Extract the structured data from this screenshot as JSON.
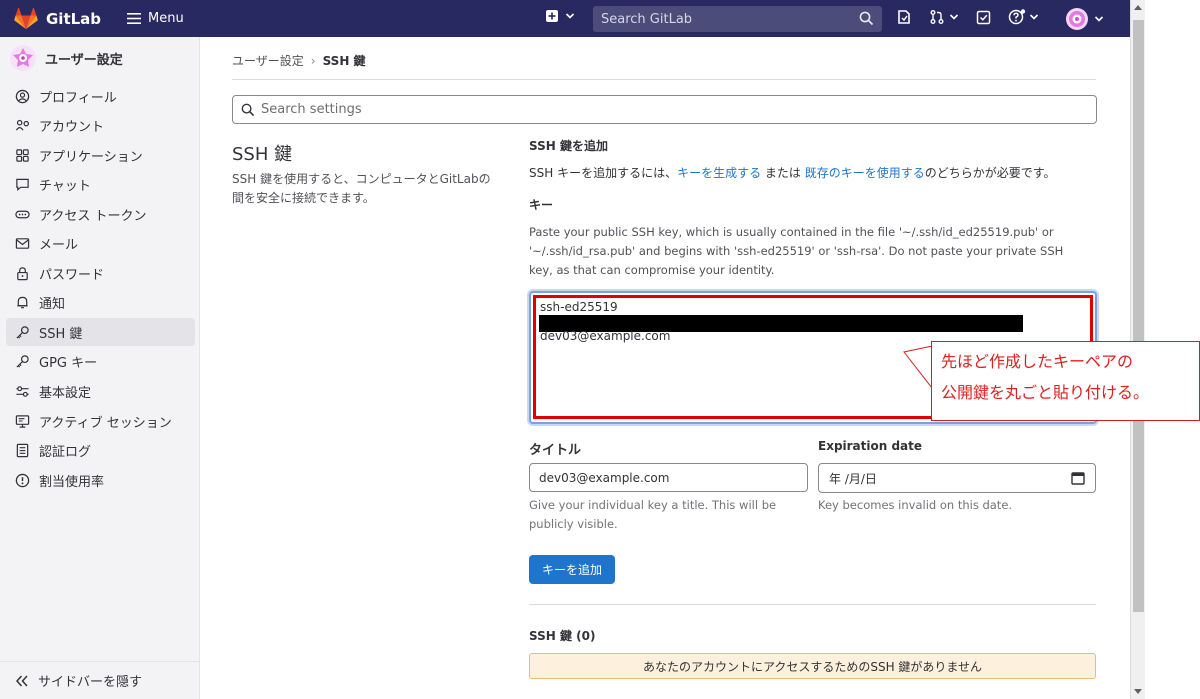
{
  "topbar": {
    "brand": "GitLab",
    "menu_label": "Menu",
    "search_placeholder": "Search GitLab",
    "colors": {
      "background": "#292961",
      "logo": "#e24329"
    }
  },
  "sidebar": {
    "title": "ユーザー設定",
    "items": [
      {
        "label": "プロフィール",
        "icon": "profile-icon"
      },
      {
        "label": "アカウント",
        "icon": "account-icon"
      },
      {
        "label": "アプリケーション",
        "icon": "applications-icon"
      },
      {
        "label": "チャット",
        "icon": "chat-icon"
      },
      {
        "label": "アクセス トークン",
        "icon": "token-icon"
      },
      {
        "label": "メール",
        "icon": "mail-icon"
      },
      {
        "label": "パスワード",
        "icon": "lock-icon"
      },
      {
        "label": "通知",
        "icon": "bell-icon"
      },
      {
        "label": "SSH 鍵",
        "icon": "key-icon",
        "active": true
      },
      {
        "label": "GPG キー",
        "icon": "key-icon"
      },
      {
        "label": "基本設定",
        "icon": "preferences-icon"
      },
      {
        "label": "アクティブ セッション",
        "icon": "monitor-icon"
      },
      {
        "label": "認証ログ",
        "icon": "log-icon"
      },
      {
        "label": "割当使用率",
        "icon": "usage-icon"
      }
    ],
    "collapse_label": "サイドバーを隠す"
  },
  "breadcrumb": {
    "parent": "ユーザー設定",
    "current": "SSH 鍵"
  },
  "settings_search": {
    "placeholder": "Search settings"
  },
  "section": {
    "title": "SSH 鍵",
    "description": "SSH 鍵を使用すると、コンピュータとGitLabの間を安全に接続できます。"
  },
  "add_key": {
    "heading": "SSH 鍵を追加",
    "intro_prefix": "SSH キーを追加するには、",
    "generate_link": "キーを生成する",
    "intro_middle": " または ",
    "existing_link": "既存のキーを使用する",
    "intro_suffix": "のどちらかが必要です。",
    "key_label": "キー",
    "key_help": "Paste your public SSH key, which is usually contained in the file '~/.ssh/id_ed25519.pub' or '~/.ssh/id_rsa.pub' and begins with 'ssh-ed25519' or 'ssh-rsa'. Do not paste your private SSH key, as that can compromise your identity.",
    "key_line1": "ssh-ed25519",
    "key_line3": "dev03@example.com",
    "title_label": "タイトル",
    "title_value": "dev03@example.com",
    "title_help": "Give your individual key a title. This will be publicly visible.",
    "expiration_label": "Expiration date",
    "expiration_placeholder": "年 /月/日",
    "expiration_help": "Key becomes invalid on this date.",
    "submit_label": "キーを追加"
  },
  "callout": {
    "line1": "先ほど作成したキーペアの",
    "line2": "公開鍵を丸ごと貼り付ける。"
  },
  "keys_list": {
    "heading": "SSH 鍵 (0)",
    "empty_message": "あなたのアカウントにアクセスするためのSSH 鍵がありません"
  }
}
